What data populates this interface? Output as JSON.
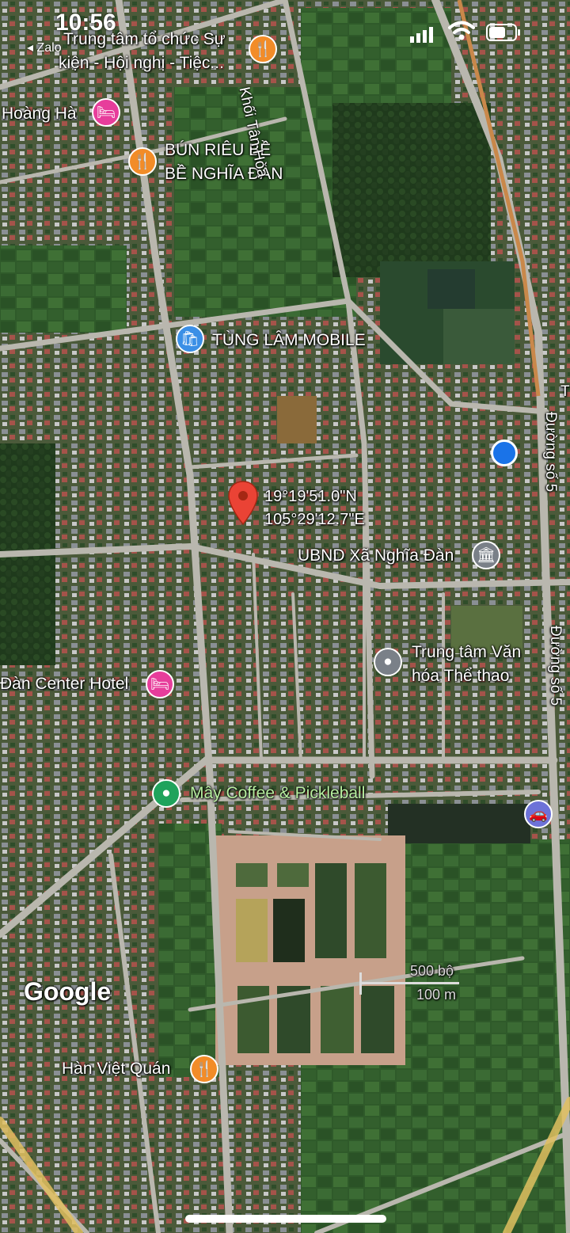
{
  "status_bar": {
    "time": "10:56",
    "back_app": "Zalo"
  },
  "pin": {
    "lat": "19°19'51.0\"N",
    "lng": "105°29'12.7\"E"
  },
  "pois": [
    {
      "id": "poi-event-center",
      "label": "Trung tâm tổ chức Sự\nkiện - Hội nghị - Tiệc...",
      "type": "restaurant",
      "color": "#f28c28"
    },
    {
      "id": "poi-hoang-ha",
      "label": "Hoàng Hà",
      "type": "hotel",
      "color": "#e73d9b"
    },
    {
      "id": "poi-bun-rieu",
      "label": "BÚN RIÊU BỀ\nBỀ NGHĨA ĐÀN",
      "type": "restaurant",
      "color": "#f28c28"
    },
    {
      "id": "poi-tung-lam",
      "label": "TÙNG LÂM MOBILE",
      "type": "shopping",
      "color": "#3b8fe6"
    },
    {
      "id": "poi-ubnd",
      "label": "UBND Xã Nghĩa Đàn",
      "type": "government",
      "color": "#7a8088"
    },
    {
      "id": "poi-van-hoa",
      "label": "Trung tâm Văn\nhóa Thể thao",
      "type": "place",
      "color": "#7a8088"
    },
    {
      "id": "poi-center-hotel",
      "label": "Đàn Center Hotel",
      "type": "hotel",
      "color": "#e73d9b"
    },
    {
      "id": "poi-may-coffee",
      "label": "Mây Coffee & Pickleball",
      "type": "cafe",
      "color": "#1fa35c"
    },
    {
      "id": "poi-han-viet",
      "label": "Hàn Việt Quán",
      "type": "restaurant",
      "color": "#f28c28"
    },
    {
      "id": "poi-transport",
      "label": "",
      "type": "transport",
      "color": "#6d72d8"
    }
  ],
  "roads": {
    "khoi_tan_hoa": "Khối Tân Hòa",
    "duong_so_5_a": "Đường số 5",
    "duong_so_5_b": "Đường số 5",
    "edge_letter": "T"
  },
  "scale": {
    "imperial": "500 bộ",
    "metric": "100 m"
  },
  "brand": "Google",
  "colors": {
    "pin": "#ea4335",
    "my_location": "#1a73e8"
  }
}
